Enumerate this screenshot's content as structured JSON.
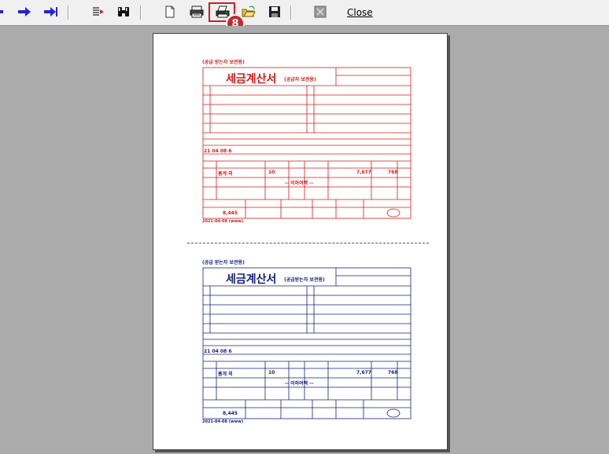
{
  "toolbar": {
    "close_label": "Close",
    "badge_number": "8",
    "highlight_color": "#cc1f1f",
    "icons": [
      "first-page-icon",
      "next-page-icon",
      "last-page-icon",
      "page-select-icon",
      "find-icon",
      "page-setup-icon",
      "printer-setup-icon",
      "print-icon",
      "open-icon",
      "save-icon",
      "export-icon"
    ]
  },
  "invoice_red": {
    "top_note": "(공급 받는자 보관용)",
    "title": "세금계산서",
    "subtitle": "(공급자 보관용)",
    "item_name": "홈게 외",
    "qty": "10",
    "supply": "7,677",
    "tax": "768",
    "total": "8,445",
    "remark": "-- 이하여백 --",
    "date": "21 04 08 6",
    "footer": "2021-04-08 (www)",
    "color": "#d01c1c"
  },
  "invoice_blue": {
    "top_note": "(공급 받는자 보관용)",
    "title": "세금계산서",
    "subtitle": "(공급받는자 보관용)",
    "item_name": "홈게 외",
    "qty": "10",
    "supply": "7,677",
    "tax": "768",
    "total": "8,445",
    "remark": "-- 이하여백 --",
    "date": "21 04 08 6",
    "footer": "2021-04-08 (www)",
    "color": "#16207a"
  }
}
